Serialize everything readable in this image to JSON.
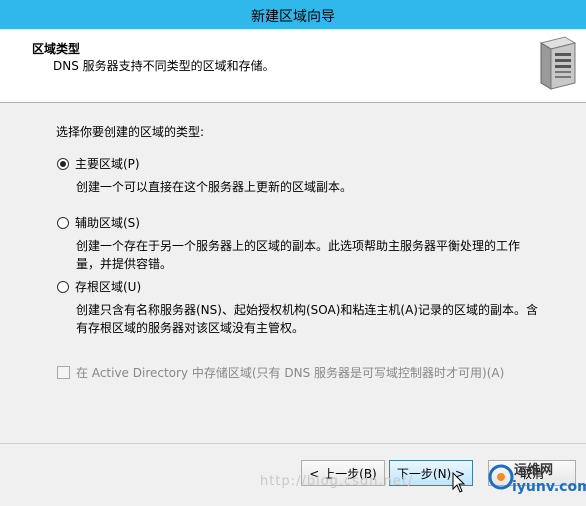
{
  "window": {
    "title": "新建区域向导"
  },
  "header": {
    "title": "区域类型",
    "subtitle": "DNS 服务器支持不同类型的区域和存储。",
    "icon": "server-icon"
  },
  "main": {
    "prompt": "选择你要创建的区域的类型:",
    "options": [
      {
        "label": "主要区域(P)",
        "selected": true,
        "description": "创建一个可以直接在这个服务器上更新的区域副本。"
      },
      {
        "label": "辅助区域(S)",
        "selected": false,
        "description_line1": "创建一个存在于另一个服务器上的区域的副本。此选项帮助主服务器平衡处理的工作",
        "description_line2": "量，并提供容错。"
      },
      {
        "label": "存根区域(U)",
        "selected": false,
        "description_line1": "创建只含有名称服务器(NS)、起始授权机构(SOA)和粘连主机(A)记录的区域的副本。含",
        "description_line2": "有存根区域的服务器对该区域没有主管权。"
      }
    ],
    "ad_checkbox": {
      "label": "在 Active Directory 中存储区域(只有 DNS 服务器是可写域控制器时才可用)(A)",
      "checked": false,
      "enabled": false
    }
  },
  "footer": {
    "back_label": "< 上一步(B)",
    "next_label": "下一步(N) >",
    "cancel_label": "取消"
  },
  "overlay": {
    "watermark": "http://blog.csdn.net/",
    "logo_top": "运维网",
    "logo_bottom": "iyunv.com"
  },
  "colors": {
    "titlebar": "#30b8ec",
    "primary_button": "#bee6fd"
  }
}
